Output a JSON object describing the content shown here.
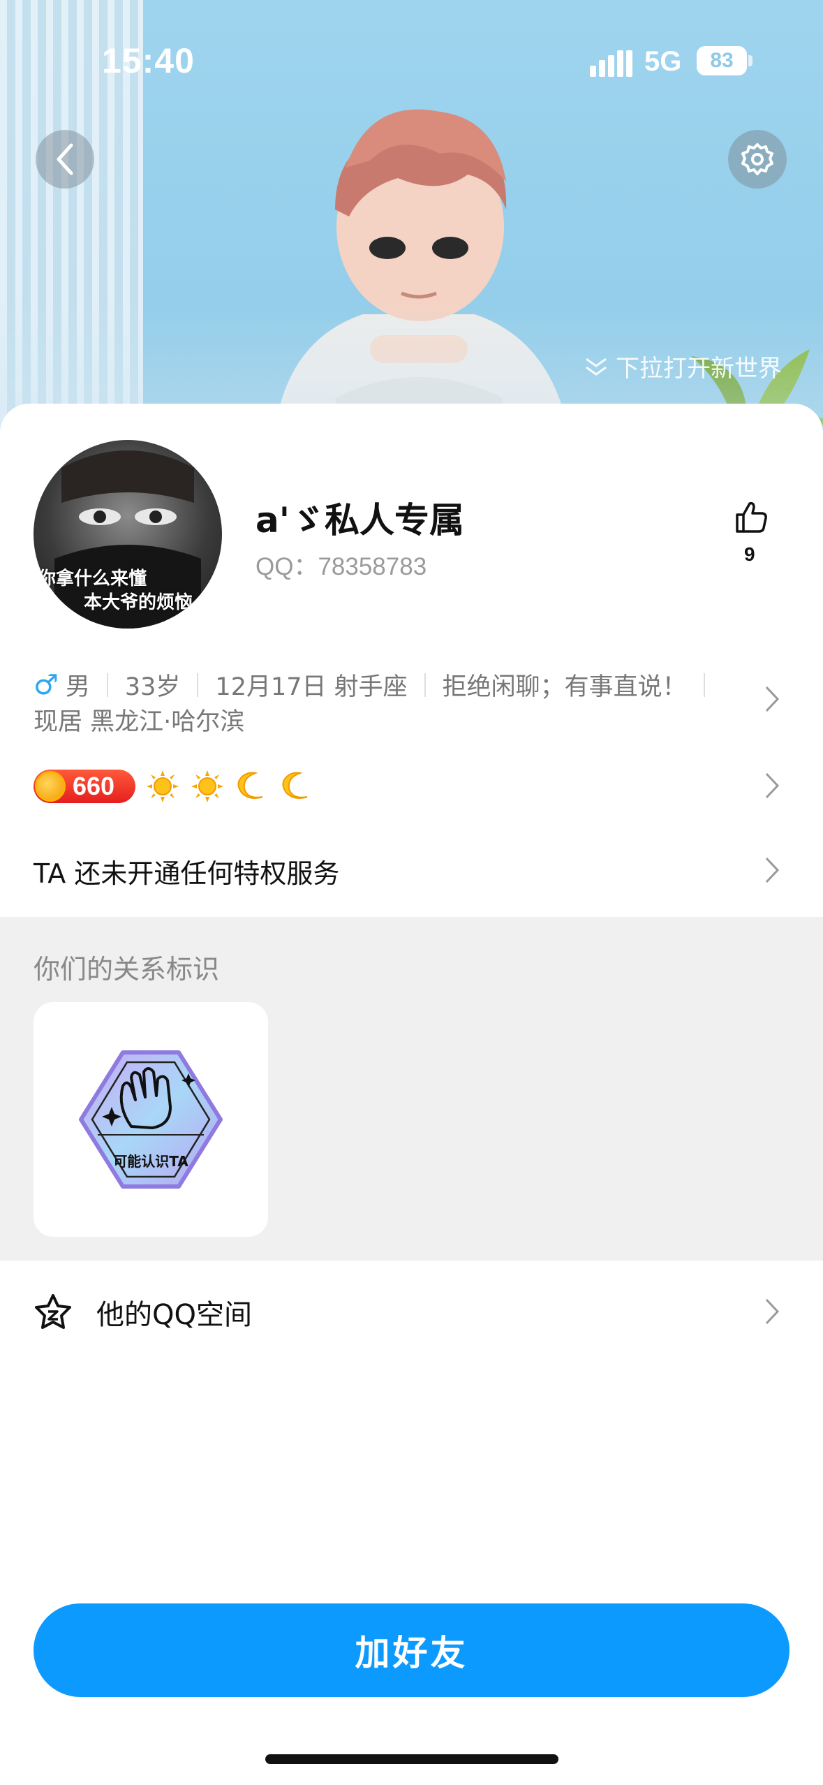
{
  "status_bar": {
    "time": "15:40",
    "network": "5G",
    "battery": "83"
  },
  "cover": {
    "pull_hint": "下拉打开新世界"
  },
  "profile": {
    "photo_caption_1": "你拿什么来懂",
    "photo_caption_2": "本大爷的烦恼",
    "nickname": "a'ゞ私人专属",
    "qq_number": "QQ：78358783",
    "likes": "9"
  },
  "info": {
    "gender": "男",
    "age": "33岁",
    "birthday": "12月17日 射手座",
    "signature": "拒绝闲聊；有事直说！",
    "location": "现居 黑龙江·哈尔滨"
  },
  "level": {
    "score": "660",
    "icons": [
      "sun-icon",
      "sun-icon",
      "moon-icon",
      "moon-icon"
    ]
  },
  "privilege_text": "TA 还未开通任何特权服务",
  "relation": {
    "title": "你们的关系标识",
    "badge_label": "可能认识TA"
  },
  "qzone": {
    "label": "他的QQ空间"
  },
  "actions": {
    "add_friend": "加好友"
  },
  "colors": {
    "accent": "#0D9AFF",
    "male": "#2AA8F0",
    "coin_badge": "#E51F1F"
  }
}
